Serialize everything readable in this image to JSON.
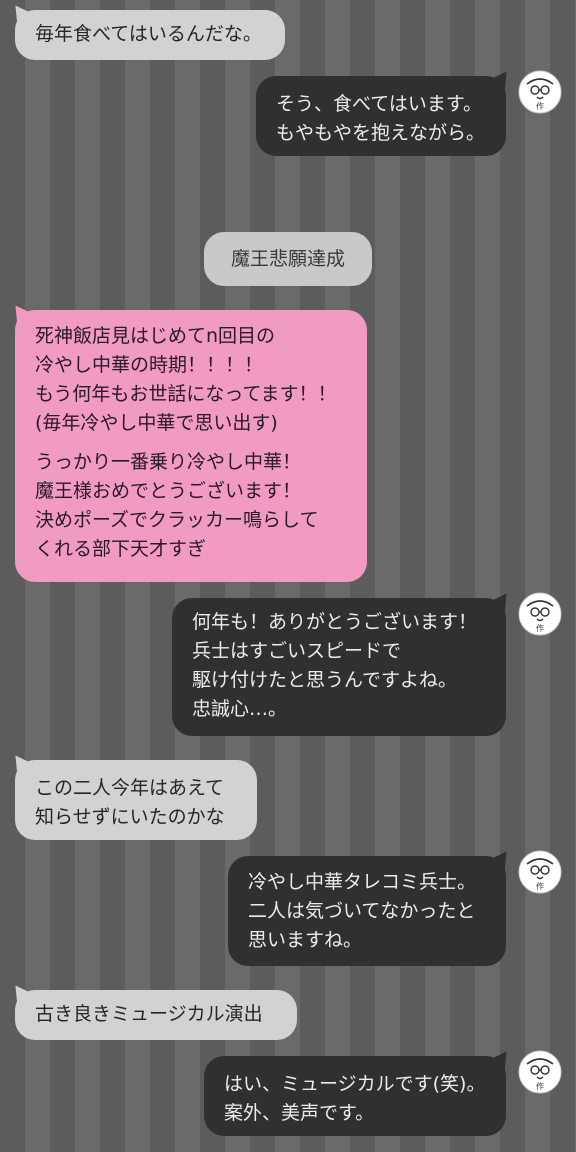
{
  "messages": [
    {
      "side": "left",
      "lines": [
        "毎年食べてはいるんだな。"
      ]
    },
    {
      "side": "right",
      "lines": [
        "そう、食べてはいます。",
        "もやもやを抱えながら。"
      ]
    },
    {
      "side": "system",
      "text": "魔王悲願達成"
    },
    {
      "side": "left",
      "style": "pink",
      "lines": [
        "死神飯店見はじめてn回目の",
        "冷やし中華の時期！！！！",
        "もう何年もお世話になってます！！",
        "(毎年冷やし中華で思い出す)"
      ],
      "lines2": [
        "うっかり一番乗り冷やし中華！",
        "魔王様おめでとうございます！",
        "決めポーズでクラッカー鳴らして",
        "くれる部下天才すぎ"
      ]
    },
    {
      "side": "right",
      "lines": [
        "何年も！ありがとうございます！",
        "兵士はすごいスピードで",
        "駆け付けたと思うんですよね。",
        "忠誠心…。"
      ]
    },
    {
      "side": "left",
      "lines": [
        "この二人今年はあえて",
        "知らせずにいたのかな"
      ]
    },
    {
      "side": "right",
      "lines": [
        "冷やし中華タレコミ兵士。",
        "二人は気づいてなかったと",
        "思いますね。"
      ]
    },
    {
      "side": "left",
      "lines": [
        "古き良きミュージカル演出"
      ]
    },
    {
      "side": "right",
      "lines": [
        "はい、ミュージカルです(笑)。",
        "案外、美声です。"
      ]
    }
  ],
  "author_avatar": {
    "icon": "author-avatar-icon",
    "label": "作"
  },
  "colors": {
    "left_bubble": "#d2d2d2",
    "pink_bubble": "#f19ac2",
    "right_bubble": "#303030",
    "system_bubble": "#c9c9c9",
    "stripe_dark": "#5c5c5c",
    "stripe_light": "#6a6a6a"
  }
}
